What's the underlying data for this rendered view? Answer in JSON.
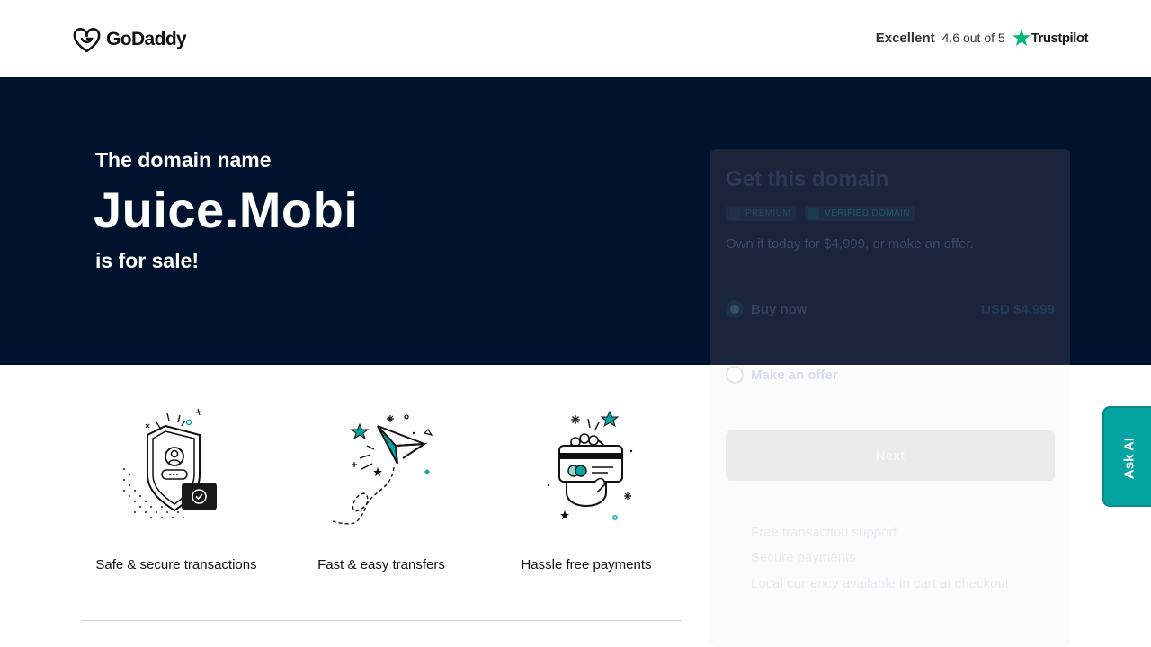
{
  "header": {
    "logo_text": "GoDaddy",
    "rating": {
      "label": "Excellent",
      "score_text": "4.6 out of 5",
      "provider": "Trustpilot"
    }
  },
  "hero": {
    "lead": "The domain name",
    "domain": "Juice.Mobi",
    "tail": "is for sale!"
  },
  "features": [
    {
      "icon": "shield-secure-icon",
      "label": "Safe & secure transactions"
    },
    {
      "icon": "paper-plane-icon",
      "label": "Fast & easy transfers"
    },
    {
      "icon": "payment-card-hand-icon",
      "label": "Hassle free payments"
    }
  ],
  "card": {
    "title": "Get this domain",
    "badges": [
      "PREMIUM",
      "VERIFIED DOMAIN"
    ],
    "description": "Own it today for $4,999, or make an offer.",
    "options": {
      "buy_now": {
        "label": "Buy now",
        "price": "USD $4,999",
        "selected": true
      },
      "make_offer": {
        "label": "Make an offer",
        "selected": false
      }
    },
    "next_label": "Next",
    "perks": [
      "Free transaction support",
      "Secure payments",
      "Local currency available in cart at checkout"
    ]
  },
  "ask_ai": {
    "label": "Ask AI"
  },
  "colors": {
    "hero_bg": "#00132e",
    "accent_teal": "#06a3a3",
    "trustpilot_green": "#00b67a"
  }
}
